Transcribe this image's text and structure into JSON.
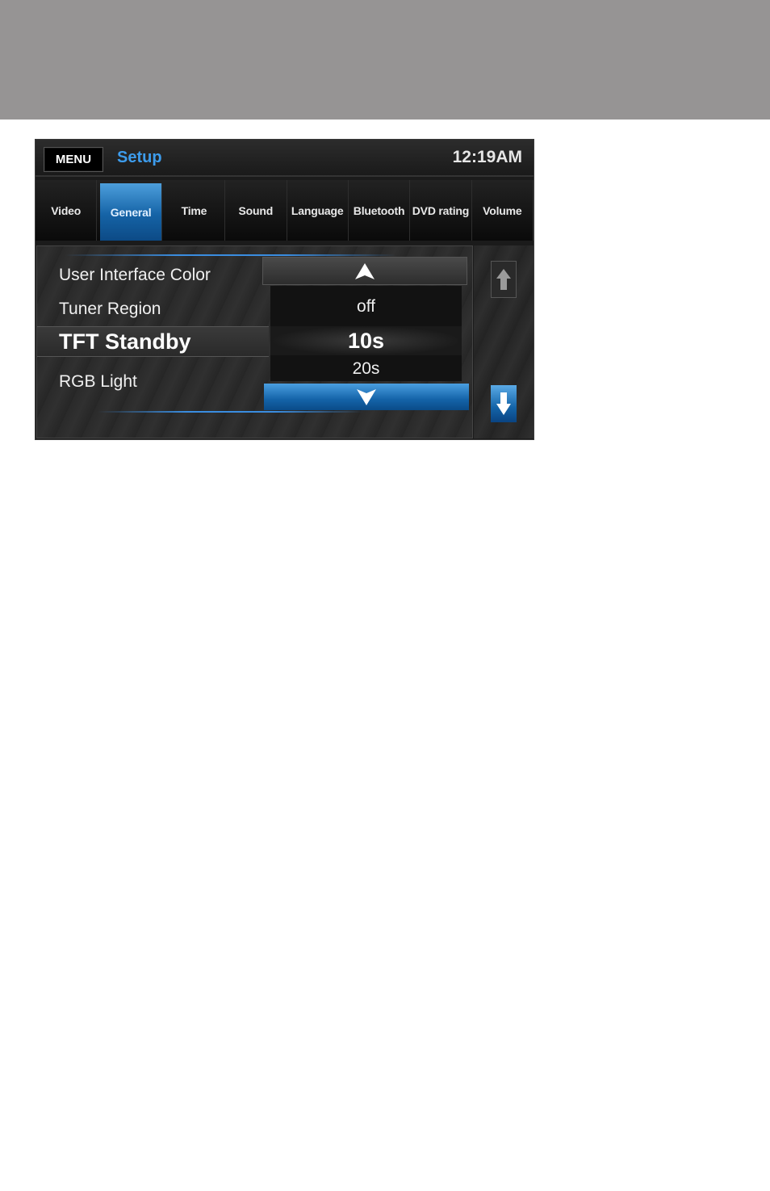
{
  "header": {
    "menu_label": "MENU",
    "title": "Setup",
    "clock": "12:19AM"
  },
  "tabs": [
    {
      "label": "Video",
      "active": false
    },
    {
      "label": "General",
      "active": true
    },
    {
      "label": "Time",
      "active": false
    },
    {
      "label": "Sound",
      "active": false
    },
    {
      "label": "Language",
      "active": false
    },
    {
      "label": "Bluetooth",
      "active": false
    },
    {
      "label": "DVD rating",
      "active": false
    },
    {
      "label": "Volume",
      "active": false
    }
  ],
  "settings": [
    {
      "label": "User Interface Color"
    },
    {
      "label": "Tuner Region"
    },
    {
      "label": "TFT Standby",
      "selected": true
    },
    {
      "label": "RGB Light"
    }
  ],
  "picker": {
    "options": [
      "off",
      "10s",
      "20s"
    ],
    "selected": "10s"
  },
  "colors": {
    "accent": "#3d9cec",
    "active_tab": "#1563a6",
    "top_bar": "#969494"
  }
}
